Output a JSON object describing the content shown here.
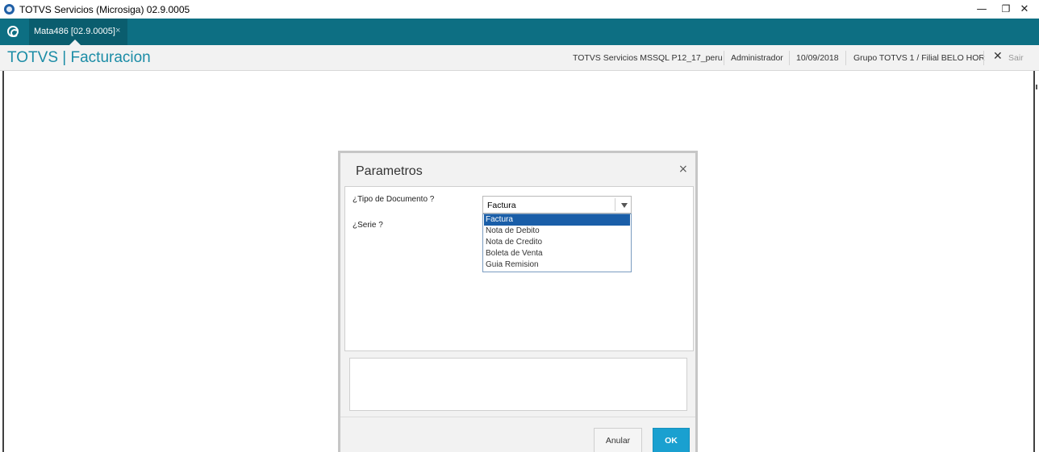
{
  "window": {
    "title": "TOTVS Servicios (Microsiga) 02.9.0005",
    "minimize_glyph": "—",
    "restore_glyph": "❐",
    "close_glyph": "✕"
  },
  "tabs": [
    {
      "label": "Mata486 [02.9.0005]",
      "close_glyph": "×"
    }
  ],
  "header": {
    "brand": "TOTVS | Facturacion",
    "environment": "TOTVS Servicios MSSQL P12_17_peru",
    "user": "Administrador",
    "date": "10/09/2018",
    "company": "Grupo TOTVS 1 / Filial BELO HOR",
    "exit_glyph": "✕",
    "exit_label": "Sair"
  },
  "dialog": {
    "title": "Parametros",
    "close_glyph": "×",
    "params": [
      {
        "label": "¿Tipo de Documento ?"
      },
      {
        "label": "¿Serie ?"
      }
    ],
    "select": {
      "value": "Factura",
      "options": [
        "Factura",
        "Nota de Debito",
        "Nota de Credito",
        "Boleta de Venta",
        "Guia Remision"
      ]
    },
    "buttons": {
      "cancel": "Anular",
      "ok": "OK"
    }
  },
  "colors": {
    "tabstrip": "#0d6f83",
    "brand_text": "#1b8ca6",
    "selected_option": "#1a5ea8",
    "ok_button": "#1aa0d0"
  }
}
